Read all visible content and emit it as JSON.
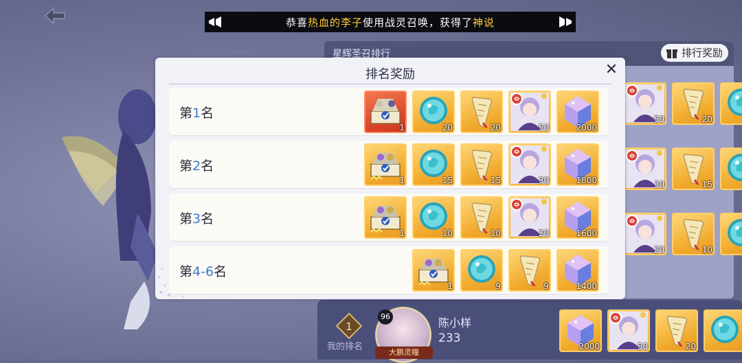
{
  "banner": {
    "prefix": "恭喜",
    "player": "热血的李子",
    "middle": "使用战灵召唤，获得了",
    "reward": "神说"
  },
  "ranking_panel": {
    "title": "星辉圣召排行",
    "rank_button": "排行奖励",
    "preview_items": [
      {
        "type": "character",
        "count": "50"
      },
      {
        "type": "scroll",
        "count": "20"
      },
      {
        "type": "orb",
        "count": ""
      },
      {
        "type": "character",
        "count": "30"
      },
      {
        "type": "scroll",
        "count": "15"
      },
      {
        "type": "orb",
        "count": ""
      },
      {
        "type": "character",
        "count": "20"
      },
      {
        "type": "scroll",
        "count": "10"
      },
      {
        "type": "orb",
        "count": ""
      }
    ]
  },
  "my_rank": {
    "rank": "1",
    "label": "我的排名",
    "level": "96",
    "name": "陈小样",
    "score": "233",
    "title_badge": "大鹏灵瞳",
    "items": [
      {
        "type": "crystal",
        "count": "2000"
      },
      {
        "type": "character",
        "count": "50"
      },
      {
        "type": "scroll",
        "count": "20"
      },
      {
        "type": "orb",
        "count": ""
      }
    ]
  },
  "dialog": {
    "title": "排名奖励",
    "close_label": "✕",
    "rows": [
      {
        "prefix": "第",
        "num": "1",
        "suffix": "名",
        "items": [
          {
            "type": "chest-red",
            "count": "1"
          },
          {
            "type": "orb",
            "count": "20"
          },
          {
            "type": "scroll",
            "count": "20"
          },
          {
            "type": "character",
            "count": "50"
          },
          {
            "type": "crystal",
            "count": "2000"
          }
        ]
      },
      {
        "prefix": "第",
        "num": "2",
        "suffix": "名",
        "items": [
          {
            "type": "chest",
            "count": "1"
          },
          {
            "type": "orb",
            "count": "15"
          },
          {
            "type": "scroll",
            "count": "15"
          },
          {
            "type": "character",
            "count": "30"
          },
          {
            "type": "crystal",
            "count": "1800"
          }
        ]
      },
      {
        "prefix": "第",
        "num": "3",
        "suffix": "名",
        "items": [
          {
            "type": "chest",
            "count": "1"
          },
          {
            "type": "orb",
            "count": "10"
          },
          {
            "type": "scroll",
            "count": "10"
          },
          {
            "type": "character",
            "count": "20"
          },
          {
            "type": "crystal",
            "count": "1600"
          }
        ]
      },
      {
        "prefix": "第",
        "num": "4-6",
        "suffix": "名",
        "items": [
          {
            "type": "chest",
            "count": "1"
          },
          {
            "type": "orb",
            "count": "9"
          },
          {
            "type": "scroll",
            "count": "9"
          },
          {
            "type": "crystal",
            "count": "1400"
          }
        ]
      }
    ]
  },
  "colors": {
    "item_gold": "#f0a92b",
    "item_red": "#d8432a",
    "rank_number": "#3f78d8",
    "banner_highlight": "#ffcc33"
  }
}
